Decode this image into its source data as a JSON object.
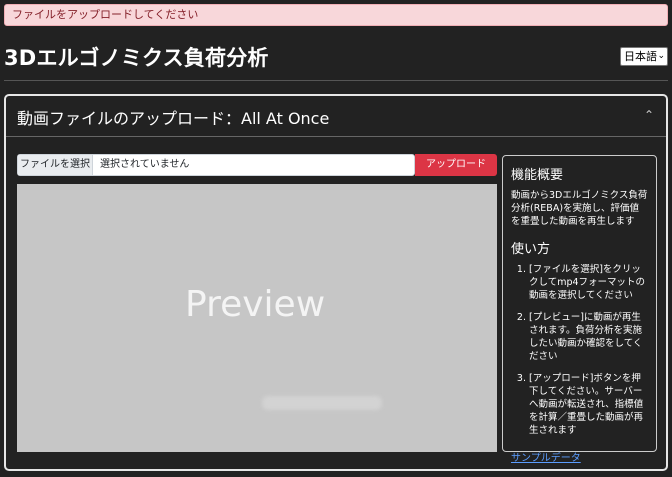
{
  "alert": {
    "message": "ファイルをアップロードしてください"
  },
  "header": {
    "title": "3Dエルゴノミクス負荷分析",
    "language": "日本語"
  },
  "card": {
    "title": "動画ファイルのアップロード：All At Once",
    "collapse_icon": "chevron-up-icon"
  },
  "upload": {
    "choose_file_label": "ファイルを選択",
    "file_status": "選択されていません",
    "upload_button": "アップロード"
  },
  "preview": {
    "label": "Preview"
  },
  "info": {
    "overview_heading": "機能概要",
    "overview_text": "動画から3Dエルゴノミクス負荷分析(REBA)を実施し、評価値を重畳した動画を再生します",
    "howto_heading": "使い方",
    "steps": [
      "[ファイルを選択]をクリックしてmp4フォーマットの動画を選択してください",
      "[プレビュー]に動画が再生されます。負荷分析を実施したい動画か確認をしてください",
      "[アップロード]ボタンを押下してください。サーバーへ動画が転送され、指標値を計算／重畳した動画が再生されます"
    ],
    "sample_link": "サンプルデータ"
  },
  "colors": {
    "background": "#222222",
    "alert_bg": "#f8d7da",
    "upload_button": "#dc3545",
    "link": "#5b9dff"
  }
}
